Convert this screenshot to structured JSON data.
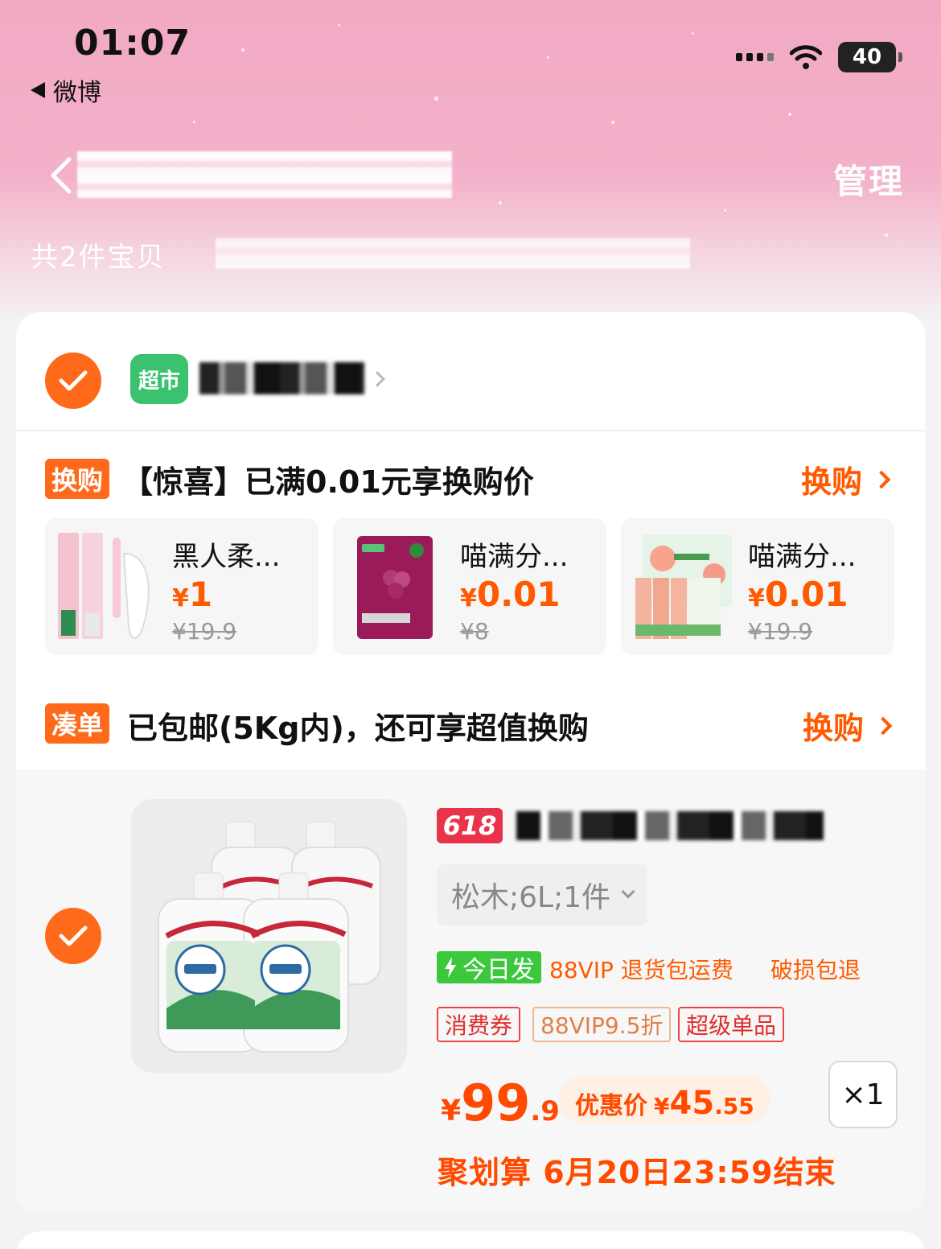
{
  "status_bar": {
    "time": "01:07",
    "back_app": "微博",
    "battery": "40"
  },
  "header": {
    "manage_label": "管理",
    "item_count": "共2件宝贝"
  },
  "store": {
    "badge": "超市"
  },
  "exchange": {
    "tag": "换购",
    "text": "【惊喜】已满0.01元享换购价",
    "link": "换购",
    "deals": [
      {
        "name": "黑人柔...",
        "currency": "¥",
        "price": "1",
        "original": "¥19.9"
      },
      {
        "name": "喵满分...",
        "currency": "¥",
        "price": "0.01",
        "original": "¥8"
      },
      {
        "name": "喵满分...",
        "currency": "¥",
        "price": "0.01",
        "original": "¥19.9"
      }
    ]
  },
  "bundle": {
    "tag": "凑单",
    "text": "已包邮(5Kg内)，还可享超值换购",
    "link": "换购"
  },
  "product": {
    "badge": "618",
    "sku": "松木;6L;1件",
    "today_ship": "今日发",
    "services": [
      "88VIP 退货包运费",
      "破损包退"
    ],
    "chips": [
      "消费券",
      "88VIP9.5折",
      "超级单品"
    ],
    "price": {
      "currency": "¥",
      "integer": "99",
      "decimal": ".9"
    },
    "discount": {
      "label": "优惠价",
      "currency": "¥",
      "integer": "45",
      "decimal": ".55"
    },
    "quantity": "×1",
    "deadline": "聚划算 6月20日23:59结束"
  },
  "colors": {
    "accent": "#ff5a00",
    "check": "#ff6a1a",
    "header_pink": "#f2a9c4",
    "green": "#3ac26f"
  }
}
